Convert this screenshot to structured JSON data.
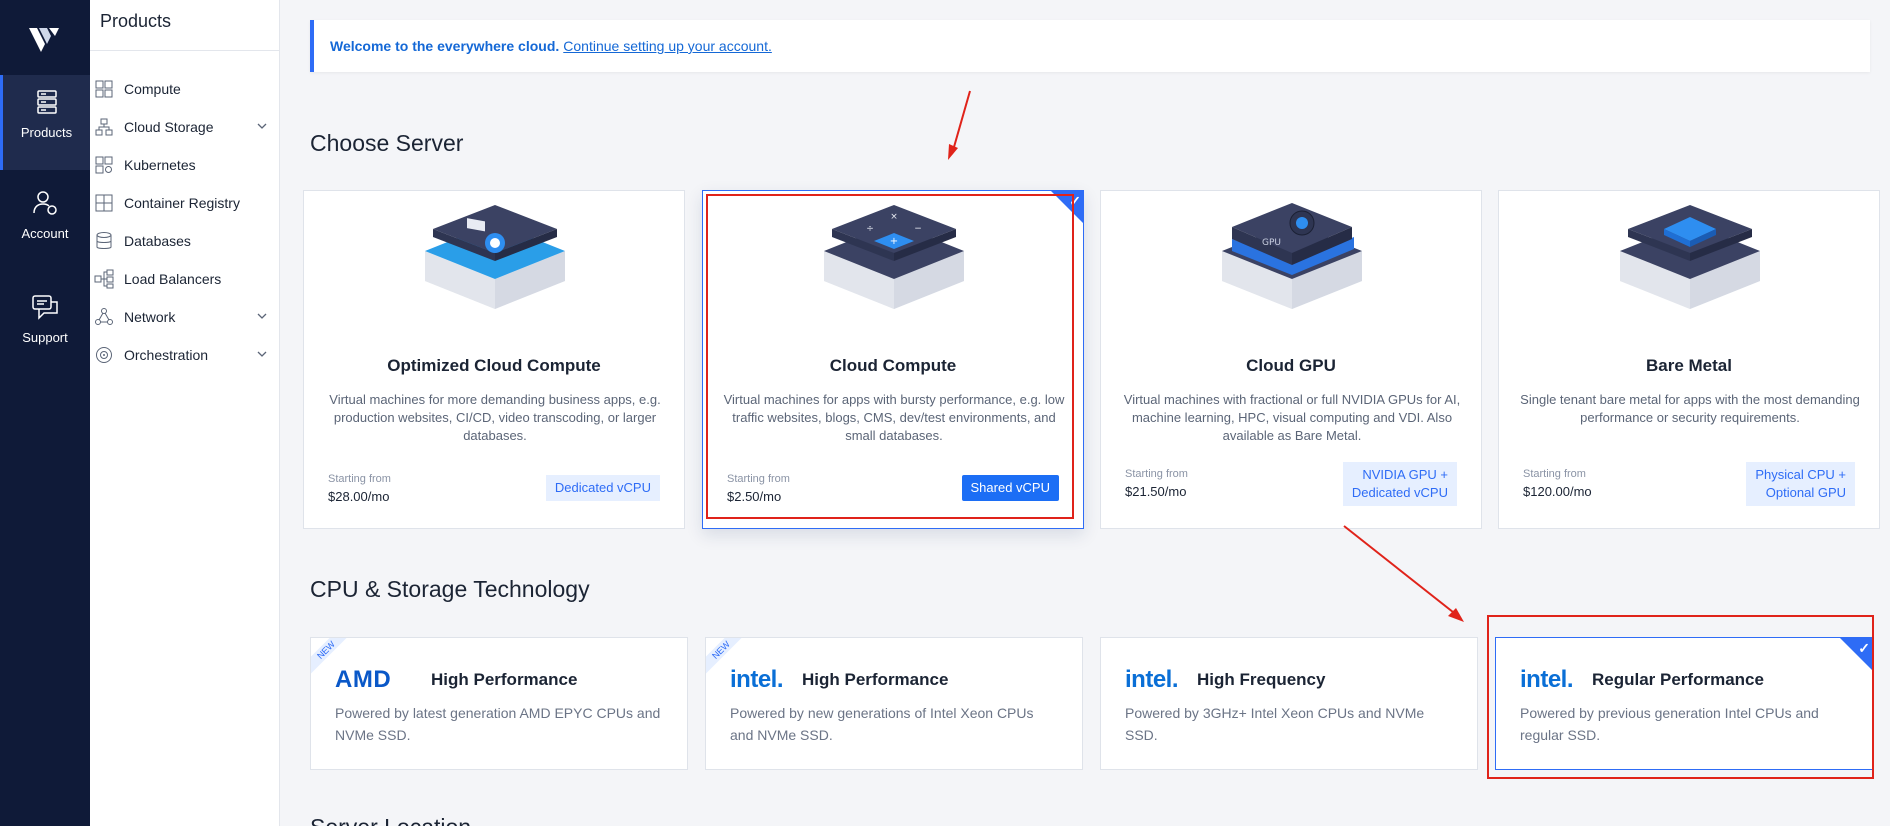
{
  "rail": {
    "items": [
      {
        "label": "Products",
        "icon": "server-stack-icon"
      },
      {
        "label": "Account",
        "icon": "user-gear-icon"
      },
      {
        "label": "Support",
        "icon": "chat-bubbles-icon"
      }
    ]
  },
  "sidebar": {
    "title": "Products",
    "items": [
      {
        "label": "Compute",
        "icon": "compute-icon"
      },
      {
        "label": "Cloud Storage",
        "icon": "storage-icon"
      },
      {
        "label": "Kubernetes",
        "icon": "kubernetes-icon"
      },
      {
        "label": "Container Registry",
        "icon": "container-icon"
      },
      {
        "label": "Databases",
        "icon": "database-icon"
      },
      {
        "label": "Load Balancers",
        "icon": "load-balancer-icon"
      },
      {
        "label": "Network",
        "icon": "network-icon"
      },
      {
        "label": "Orchestration",
        "icon": "orchestration-icon"
      }
    ]
  },
  "banner": {
    "bold": "Welcome to the everywhere cloud.",
    "link": "Continue setting up your account."
  },
  "choose_server": {
    "title": "Choose Server",
    "cards": [
      {
        "title": "Optimized Cloud Compute",
        "desc": "Virtual machines for more demanding business apps, e.g. production websites, CI/CD, video transcoding, or larger databases.",
        "from_label": "Starting from",
        "price": "$28.00/mo",
        "tag": "Dedicated vCPU"
      },
      {
        "title": "Cloud Compute",
        "desc": "Virtual machines for apps with bursty performance, e.g. low traffic websites, blogs, CMS, dev/test environments, and small databases.",
        "from_label": "Starting from",
        "price": "$2.50/mo",
        "tag": "Shared vCPU"
      },
      {
        "title": "Cloud GPU",
        "desc": "Virtual machines with fractional or full NVIDIA GPUs for AI, machine learning, HPC, visual computing and VDI. Also available as Bare Metal.",
        "from_label": "Starting from",
        "price": "$21.50/mo",
        "tag_line1": "NVIDIA GPU +",
        "tag_line2": "Dedicated vCPU"
      },
      {
        "title": "Bare Metal",
        "desc": "Single tenant bare metal for apps with the most demanding performance or security requirements.",
        "from_label": "Starting from",
        "price": "$120.00/mo",
        "tag_line1": "Physical CPU +",
        "tag_line2": "Optional GPU"
      }
    ]
  },
  "cpu_storage": {
    "title": "CPU & Storage Technology",
    "cards": [
      {
        "brand": "AMD",
        "perf": "High Performance",
        "desc": "Powered by latest generation AMD EPYC CPUs and NVMe SSD.",
        "badge": "NEW"
      },
      {
        "brand": "intel.",
        "perf": "High Performance",
        "desc": "Powered by new generations of Intel Xeon CPUs and NVMe SSD.",
        "badge": "NEW"
      },
      {
        "brand": "intel.",
        "perf": "High Frequency",
        "desc": "Powered by 3GHz+ Intel Xeon CPUs and NVMe SSD."
      },
      {
        "brand": "intel.",
        "perf": "Regular Performance",
        "desc": "Powered by previous generation Intel CPUs and regular SSD."
      }
    ]
  },
  "next_section_title": "Server Location",
  "colors": {
    "accent": "#2e6cf6",
    "rail_bg": "#0f1a38",
    "annotation_red": "#e0231a"
  }
}
